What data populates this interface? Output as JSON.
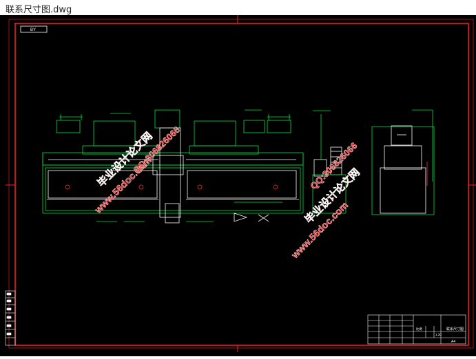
{
  "window": {
    "title": "联系尺寸图.dwg"
  },
  "drawing": {
    "view_label": "BY",
    "scale_label": "1:20",
    "titleblock_name": "联系尺寸图",
    "titleblock_sheet": "A4",
    "titleblock_scale_hdr": "比例",
    "watermarks": [
      {
        "line1": "毕业设计论文网",
        "line2": "www.56doc.com",
        "line3": "QQ:306826066"
      },
      {
        "line1": "毕业设计论文网",
        "line2": "www.56doc.com",
        "line3": "QQ:306826066"
      }
    ],
    "colors": {
      "background": "#000000",
      "border": "#ff2020",
      "geometry": "#00e040",
      "detail": "#ffffff"
    }
  }
}
